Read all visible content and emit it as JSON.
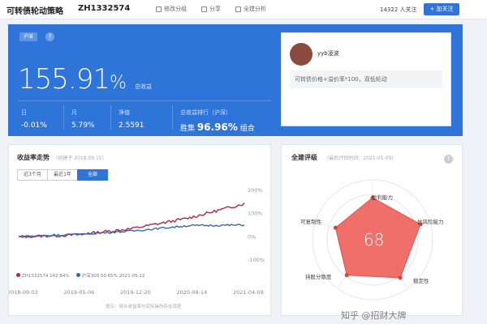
{
  "header": {
    "title": "可转债轮动策略",
    "code": "ZH1332574",
    "actions": [
      {
        "label": "修改分组",
        "icon": "edit-icon"
      },
      {
        "label": "分享",
        "icon": "share-icon"
      },
      {
        "label": "全建分析",
        "icon": "analysis-icon"
      }
    ],
    "followers": "14322 人关注",
    "follow_label": "+ 加关注"
  },
  "hero": {
    "market_badge": "沪深",
    "help": "?",
    "total_return": "155.91",
    "total_unit": "%",
    "total_label": "总收益",
    "stats": [
      {
        "label": "日",
        "value": "-0.01%"
      },
      {
        "label": "月",
        "value": "5.79%"
      },
      {
        "label": "净值",
        "value": "2.5591"
      }
    ],
    "rank_label": "总收益排行（沪深）",
    "rank_prefix": "胜集",
    "rank_value": "96.96%",
    "rank_suffix": "组合"
  },
  "user_card": {
    "username": "yyb凌波",
    "description": "可转债价格+溢价率*100，双低轮动"
  },
  "trend_panel": {
    "title": "收益率走势",
    "subtitle": "(创建于 2018.09.15)",
    "tabs": [
      "近3个月",
      "最近1年",
      "全部"
    ],
    "active_tab": 2,
    "y_ticks": [
      "200%",
      "100%",
      "0%",
      "-100%"
    ],
    "x_ticks": [
      "2018-09-03",
      "2019-05-06",
      "2019-12-20",
      "2020-08-14",
      "2021-04-09"
    ],
    "legend": [
      {
        "label": "ZH1332574 142.84%",
        "color": "#b0284a"
      },
      {
        "label": "沪深300 50.65%  2021-05-22",
        "color": "#2f6bb5"
      }
    ],
    "note": "提示：组合收益率与实际操作存在误差"
  },
  "rating_panel": {
    "title": "全建评级",
    "subtitle": "(最后评估时间：2021-05-09)",
    "score": "68",
    "dimensions": [
      "盈利能力",
      "抗风险能力",
      "稳定性",
      "持股分散度",
      "可复制性"
    ],
    "colors": {
      "fill": "#ef6f6a",
      "stroke": "#e0524c"
    }
  },
  "watermark": "知乎 @招财大牌",
  "chart_data": {
    "type": "line",
    "title": "收益率走势",
    "xlabel": "",
    "ylabel": "",
    "ylim": [
      -100,
      200
    ],
    "x": [
      "2018-09-03",
      "2019-05-06",
      "2019-12-20",
      "2020-08-14",
      "2021-04-09"
    ],
    "series": [
      {
        "name": "ZH1332574",
        "values": [
          0,
          8,
          35,
          80,
          142.84
        ]
      },
      {
        "name": "沪深300",
        "values": [
          0,
          10,
          25,
          48,
          50.65
        ]
      }
    ],
    "grid": false,
    "legend": "bottom-left"
  }
}
